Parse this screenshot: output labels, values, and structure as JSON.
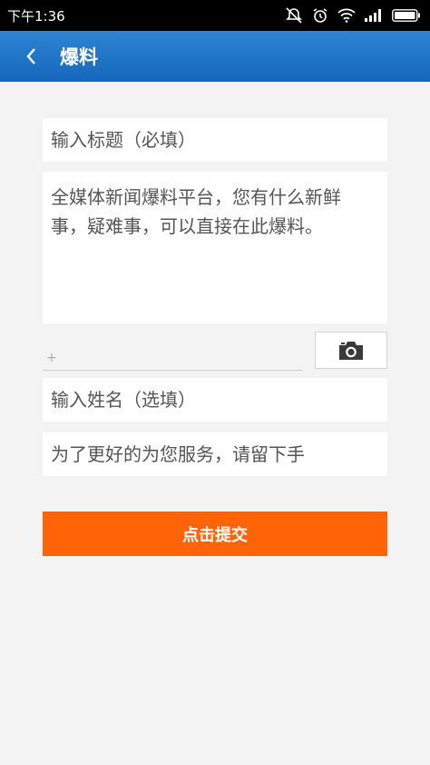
{
  "status_bar": {
    "time": "下午1:36",
    "icons": [
      "dnd-off-icon",
      "alarm-icon",
      "wifi-icon",
      "signal-icon",
      "battery-icon"
    ]
  },
  "app_bar": {
    "back_icon": "chevron-left-icon",
    "title": "爆料"
  },
  "form": {
    "title_placeholder": "输入标题（必填）",
    "content_placeholder": "全媒体新闻爆料平台，您有什么新鲜事，疑难事，可以直接在此爆料。",
    "attach_plus": "+",
    "camera_icon": "camera-icon",
    "name_placeholder": "输入姓名（选填）",
    "contact_placeholder": "为了更好的为您服务，请留下手",
    "submit_label": "点击提交"
  },
  "colors": {
    "app_bar": "#1b73c6",
    "submit": "#ff6508",
    "background": "#f3f3f3"
  }
}
